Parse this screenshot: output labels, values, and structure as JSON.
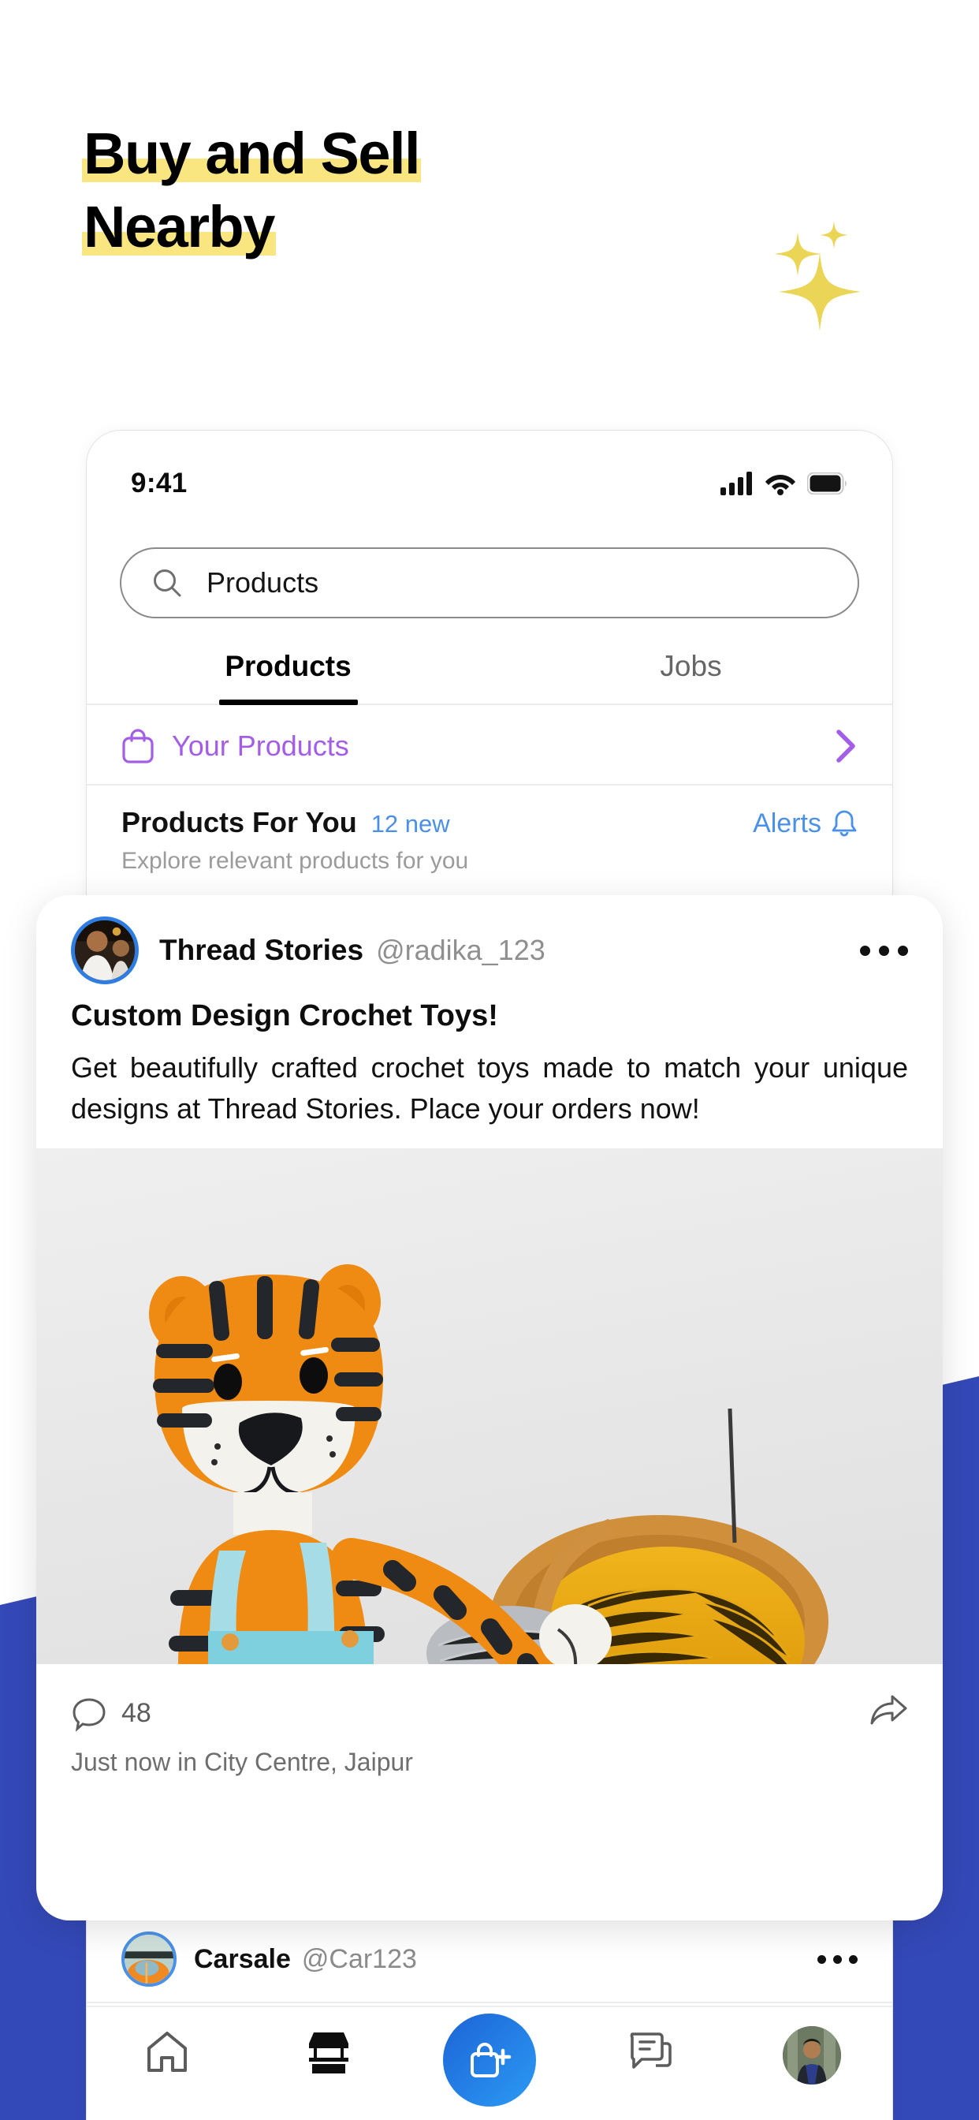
{
  "hero": {
    "title_line1": "Buy and Sell",
    "title_line2": "Nearby",
    "highlight_color": "#f9e680",
    "sparkle_color": "#ead556",
    "sparkle_icon": "sparkles-icon"
  },
  "background": {
    "accent_color": "#3449b8"
  },
  "phone": {
    "statusbar": {
      "time": "9:41",
      "icons": [
        "cellular-signal-icon",
        "wifi-icon",
        "battery-icon"
      ]
    },
    "search": {
      "icon": "search-icon",
      "value": "Products",
      "placeholder": "Products"
    },
    "tabs": [
      {
        "label": "Products",
        "active": true
      },
      {
        "label": "Jobs",
        "active": false
      }
    ],
    "your_products": {
      "icon": "shopping-bag-icon",
      "label": "Your Products",
      "chevron": "chevron-right-icon",
      "color": "#a45ee5"
    },
    "products_for_you": {
      "title": "Products For You",
      "badge": "12 new",
      "badge_color": "#4a90e8",
      "subtitle": "Explore relevant products for you",
      "alerts_label": "Alerts",
      "alerts_icon": "bell-icon"
    },
    "second_post": {
      "avatar": "carsale-avatar",
      "name": "Carsale",
      "handle": "@Car123",
      "more_icon": "more-horizontal-icon"
    },
    "bottom_nav": [
      {
        "name": "home",
        "icon": "home-icon",
        "active": false
      },
      {
        "name": "marketplace",
        "icon": "storefront-icon",
        "active": true
      },
      {
        "name": "sell",
        "icon": "bag-plus-icon",
        "active": false,
        "fab": true
      },
      {
        "name": "messages",
        "icon": "chat-bubbles-icon",
        "active": false
      },
      {
        "name": "profile",
        "icon": "profile-avatar-icon",
        "active": false
      }
    ]
  },
  "featured_post": {
    "avatar": "thread-stories-avatar",
    "name": "Thread Stories",
    "handle": "@radika_123",
    "more_icon": "more-horizontal-icon",
    "title": "Custom Design Crochet Toys!",
    "body": "Get beautifully crafted crochet toys made to match your unique designs at Thread Stories. Place your orders now!",
    "media_alt": "crochet-tiger-toy-photo",
    "comment_icon": "comment-bubble-icon",
    "comment_count": "48",
    "share_icon": "share-arrow-icon",
    "meta": "Just now in City Centre, Jaipur"
  }
}
